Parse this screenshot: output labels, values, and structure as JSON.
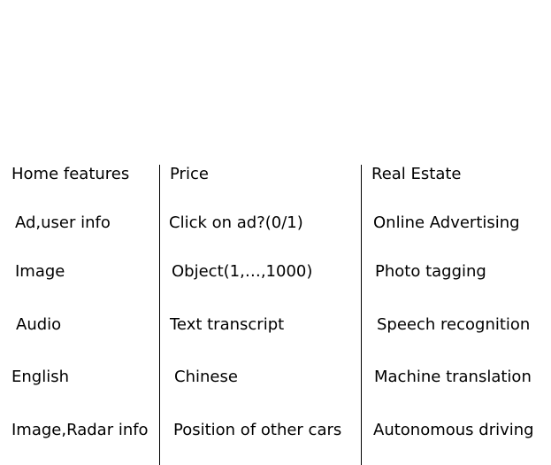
{
  "rows": [
    [
      "Home features",
      "Price",
      "Real Estate"
    ],
    [
      "Ad,user info",
      "Click on ad?(0/1)",
      "Online Advertising"
    ],
    [
      "Image",
      "Object(1,…,1000)",
      "Photo tagging"
    ],
    [
      "Audio",
      "Text transcript",
      "Speech recognition"
    ],
    [
      "English",
      "Chinese",
      "Machine translation"
    ],
    [
      "Image,Radar info",
      "Position of other cars",
      "Autonomous driving"
    ]
  ]
}
